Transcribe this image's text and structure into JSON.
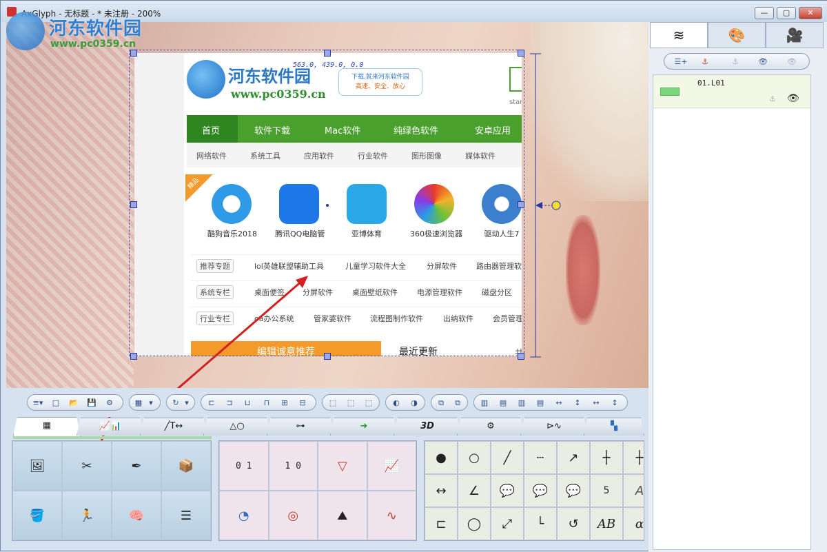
{
  "window": {
    "title": "AxGlyph - 无标题 - * 未注册 - 200%",
    "min": "—",
    "max": "▢",
    "close": "✕"
  },
  "watermark": {
    "title": "河东软件园",
    "url": "www.pc0359.cn"
  },
  "canvas": {
    "coord_readout": "563.0, 439.0, 0.0"
  },
  "site": {
    "name": "河东软件园",
    "url": "www.pc0359.cn",
    "slogan1": "下载,就来河东软件园",
    "slogan2": "高速、安全、放心",
    "search_hint": "star",
    "nav": [
      "首页",
      "软件下载",
      "Mac软件",
      "纯绿色软件",
      "安卓应用"
    ],
    "subnav": [
      "网络软件",
      "系统工具",
      "应用软件",
      "行业软件",
      "图形图像",
      "媒体软件"
    ],
    "ribbon": "精品",
    "apps": [
      {
        "name": "酷狗音乐2018",
        "color": "#2f9be6",
        "glyph": "K"
      },
      {
        "name": "腾讯QQ电脑管",
        "color": "#1d77e6",
        "glyph": "V"
      },
      {
        "name": "亚博体育",
        "color": "#2aa7e6",
        "glyph": "✿"
      },
      {
        "name": "360极速浏览器",
        "color": "#e89a2a",
        "glyph": "✺"
      },
      {
        "name": "驱动人生7",
        "color": "#3c7fcd",
        "glyph": "⚙"
      }
    ],
    "rows": [
      {
        "tag": "推荐专题",
        "items": [
          "lol英雄联盟辅助工具",
          "儿童学习软件大全",
          "分屏软件",
          "路由器管理软"
        ]
      },
      {
        "tag": "系统专栏",
        "items": [
          "桌面便签",
          "分屏软件",
          "桌面壁纸软件",
          "电源管理软件",
          "磁盘分区"
        ]
      },
      {
        "tag": "行业专栏",
        "items": [
          "oa办公系统",
          "管家婆软件",
          "流程图制作软件",
          "出纳软件",
          "会员管理"
        ]
      }
    ],
    "editor_pick": "编辑诚意推荐",
    "recent": "最近更新",
    "more": "共"
  },
  "toolbar": {
    "groups": [
      {
        "icons": [
          "≡▾",
          "□",
          "📂",
          "💾",
          "⚙"
        ]
      },
      {
        "icons": [
          "▦",
          "▾"
        ]
      },
      {
        "icons": [
          "↻",
          "▾"
        ]
      },
      {
        "icons": [
          "⊏",
          "⊐",
          "⊔",
          "⊓",
          "⊞",
          "⊟"
        ]
      },
      {
        "icons": [
          "⬚",
          "⬚",
          "⬚"
        ]
      },
      {
        "icons": [
          "◐",
          "◑"
        ]
      },
      {
        "icons": [
          "⧉",
          "⧉"
        ]
      },
      {
        "icons": [
          "▥",
          "▤",
          "▥",
          "▤",
          "↔",
          "↕",
          "↔",
          "↕"
        ]
      }
    ]
  },
  "tabs": [
    {
      "label": "▦"
    },
    {
      "label": "📈📊"
    },
    {
      "label": "╱T↔"
    },
    {
      "label": "△○"
    },
    {
      "label": "⊶"
    },
    {
      "label": "➜"
    },
    {
      "label": "3D"
    },
    {
      "label": "⚙"
    },
    {
      "label": "⊳∿"
    },
    {
      "label": "▚"
    }
  ],
  "palette1": [
    "🖼",
    "✂",
    "✒",
    "📦",
    "🪣",
    "🏃",
    "🧠",
    "☰"
  ],
  "palette2": [
    "0 1",
    "1 0",
    "▽",
    "📈",
    "◔",
    "◎",
    "⛰",
    "∿"
  ],
  "palette3": [
    "●",
    "○",
    "╱",
    "┄",
    "↗",
    "┼",
    "┼",
    "↔",
    "∠",
    "💬",
    "💬",
    "💬",
    "5",
    "A",
    "⊏",
    "◯",
    "⤢",
    "└",
    "↺",
    "AB",
    "α"
  ],
  "right": {
    "tabs": [
      "≋",
      "🎨",
      "🎥"
    ],
    "tools": [
      "☰+",
      "⚓",
      "⚓",
      "👁",
      "👁"
    ],
    "layer": {
      "name": "01.L01",
      "eye": "👁",
      "anchor": "⚓"
    }
  },
  "colors": {
    "nav_green": "#4aa02c",
    "accent_orange": "#f39a2b",
    "selection": "#2436a0",
    "arrow": "#d21f1f"
  }
}
